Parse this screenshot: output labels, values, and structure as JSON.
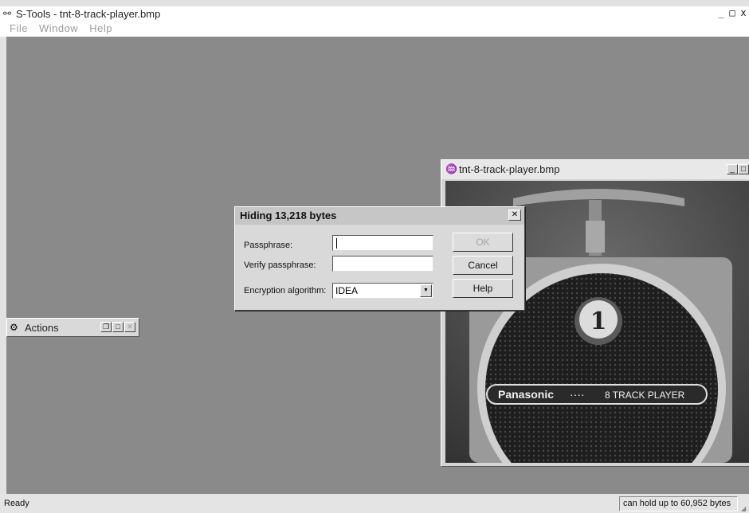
{
  "app": {
    "title": "S-Tools - tnt-8-track-player.bmp",
    "title_icon": "stools-app-icon",
    "window_controls": {
      "minimize": "_",
      "maximize": "□",
      "close": "x"
    }
  },
  "menu": {
    "items": [
      "File",
      "Window",
      "Help"
    ]
  },
  "actions_window": {
    "title": "Actions",
    "icon": "gears-icon"
  },
  "image_window": {
    "title": "tnt-8-track-player.bmp",
    "icon": "sound-waves-icon",
    "photo_text": {
      "number": "1",
      "brand": "Panasonic",
      "dots": "····",
      "product": "8 TRACK PLAYER"
    }
  },
  "dialog": {
    "title": "Hiding 13,218 bytes",
    "passphrase_label": "Passphrase:",
    "passphrase_value": "",
    "verify_label": "Verify passphrase:",
    "verify_value": "",
    "algorithm_label": "Encryption algorithm:",
    "algorithm_value": "IDEA",
    "ok_label": "OK",
    "cancel_label": "Cancel",
    "help_label": "Help"
  },
  "status": {
    "left": "Ready",
    "right": "can hold up to 60,952 bytes"
  }
}
